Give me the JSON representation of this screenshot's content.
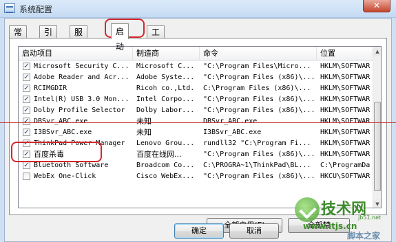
{
  "window": {
    "title": "系统配置",
    "close_glyph": "✕"
  },
  "tabs": [
    {
      "label": "常规"
    },
    {
      "label": "引导"
    },
    {
      "label": "服务"
    },
    {
      "label": "启动"
    },
    {
      "label": "工具"
    }
  ],
  "active_tab": "启动",
  "table": {
    "headers": [
      "启动项目",
      "制造商",
      "命令",
      "位置"
    ],
    "rows": [
      {
        "checked": true,
        "item": "Microsoft Security C...",
        "maker": "Microsoft C...",
        "command": "\"C:\\Program Files\\Micro...",
        "location": "HKLM\\SOFTWAR"
      },
      {
        "checked": true,
        "item": "Adobe Reader and Acr...",
        "maker": "Adobe Syste...",
        "command": "\"C:\\Program Files (x86)\\...",
        "location": "HKLM\\SOFTWAR"
      },
      {
        "checked": true,
        "item": "RCIMGDIR",
        "maker": "Ricoh co.,Ltd.",
        "command": "C:\\Program Files (x86)\\...",
        "location": "HKLM\\SOFTWAR"
      },
      {
        "checked": true,
        "item": "Intel(R) USB 3.0 Mon...",
        "maker": "Intel Corpo...",
        "command": "\"C:\\Program Files (x86)\\...",
        "location": "HKLM\\SOFTWAR"
      },
      {
        "checked": true,
        "item": "Dolby Profile Selector",
        "maker": "Dolby Labor...",
        "command": "\"C:\\Program Files (x86)\\...",
        "location": "HKLM\\SOFTWAR"
      },
      {
        "checked": true,
        "item": "DBSvr_ABC.exe",
        "maker": "未知",
        "command": "DBSvr_ABC.exe",
        "location": "HKLM\\SOFTWAR"
      },
      {
        "checked": true,
        "item": "I3BSvr_ABC.exe",
        "maker": "未知",
        "command": "I3BSvr_ABC.exe",
        "location": "HKLM\\SOFTWAR"
      },
      {
        "checked": true,
        "item": "ThinkPad Power Manager",
        "maker": "Lenovo Grou...",
        "command": "rundll32 \"C:\\Program Fi...",
        "location": "HKLM\\SOFTWAR"
      },
      {
        "checked": true,
        "item": "百度杀毒",
        "maker": "百度在线网...",
        "command": "\"C:\\Program Files (x86)\\...",
        "location": "HKLM\\SOFTWAR"
      },
      {
        "checked": true,
        "item": "Bluetooth Software",
        "maker": "Broadcom Co...",
        "command": "C:\\PROGRA~1\\ThinkPad\\BL...",
        "location": "C:\\ProgramDa"
      },
      {
        "checked": false,
        "item": "WebEx One-Click",
        "maker": "Cisco WebEx...",
        "command": "\"C:\\Program Files (x86)\\...",
        "location": "HKCU\\SOFTWAR"
      }
    ]
  },
  "buttons": {
    "enable_all": "全部启用(E)",
    "disable_all": "全部禁",
    "ok": "确定",
    "cancel": "取消"
  },
  "watermark": {
    "main": "技术网",
    "sub1": "jb51.net",
    "url": "www.itjs.cn",
    "corner": "脚本之家"
  },
  "colors": {
    "annotation_red": "#d2262c",
    "watermark_green": "#3e8b2c",
    "check_blue": "#2b4a7a"
  }
}
